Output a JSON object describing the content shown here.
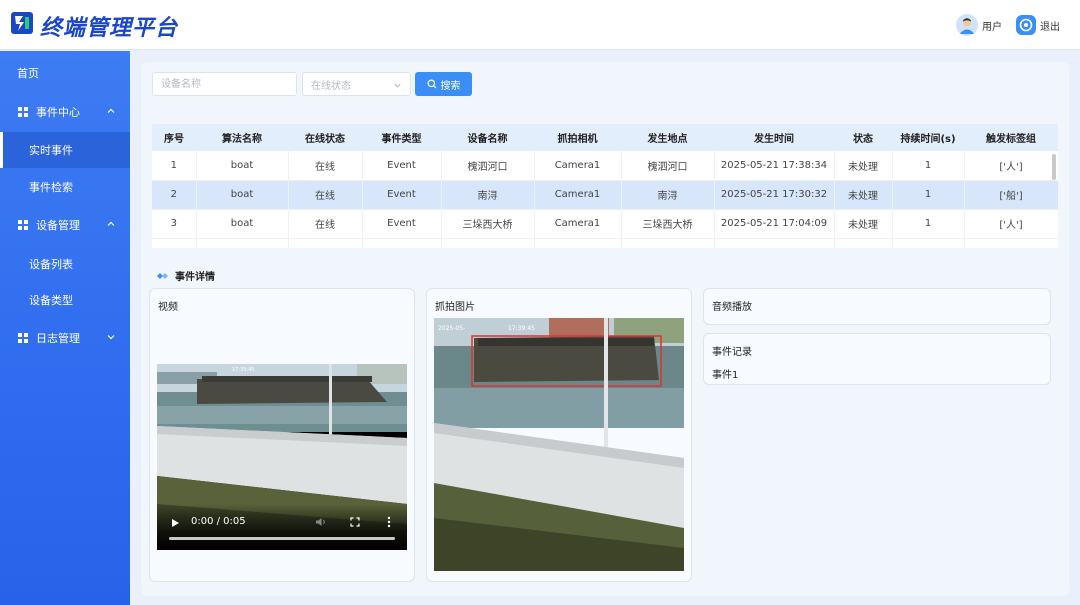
{
  "app": {
    "title": "终端管理平台"
  },
  "header": {
    "user_label": "用户",
    "logout_label": "退出"
  },
  "sidebar": {
    "items": [
      {
        "label": "首页",
        "level": 0
      },
      {
        "label": "事件中心",
        "level": 0,
        "expanded": true
      },
      {
        "label": "实时事件",
        "level": 1,
        "active": true
      },
      {
        "label": "事件检索",
        "level": 1
      },
      {
        "label": "设备管理",
        "level": 0,
        "expanded": true
      },
      {
        "label": "设备列表",
        "level": 1
      },
      {
        "label": "设备类型",
        "level": 1
      },
      {
        "label": "日志管理",
        "level": 0,
        "expanded": false
      }
    ]
  },
  "search": {
    "device_placeholder": "设备名称",
    "status_placeholder": "在线状态",
    "button_label": "搜索"
  },
  "table": {
    "headers": [
      "序号",
      "算法名称",
      "在线状态",
      "事件类型",
      "设备名称",
      "抓拍相机",
      "发生地点",
      "发生时间",
      "状态",
      "持续时间(s)",
      "触发标签组"
    ],
    "rows": [
      [
        "1",
        "boat",
        "在线",
        "Event",
        "槐泗河口",
        "Camera1",
        "槐泗河口",
        "2025-05-21 17:38:34",
        "未处理",
        "1",
        "['人']"
      ],
      [
        "2",
        "boat",
        "在线",
        "Event",
        "南浔",
        "Camera1",
        "南浔",
        "2025-05-21 17:30:32",
        "未处理",
        "1",
        "['船']"
      ],
      [
        "3",
        "boat",
        "在线",
        "Event",
        "三垛西大桥",
        "Camera1",
        "三垛西大桥",
        "2025-05-21 17:04:09",
        "未处理",
        "1",
        "['人']"
      ]
    ],
    "selected_row": 2
  },
  "details": {
    "section_title": "事件详情",
    "video": {
      "label": "视频",
      "time": "0:00 / 0:05",
      "overlay_time": "17:39:45"
    },
    "snapshot": {
      "label": "抓拍图片",
      "overlay_time": "17:39:45",
      "overlay_text": "2025-05-"
    },
    "audio": {
      "label": "音频播放"
    },
    "records": {
      "label": "事件记录",
      "items": [
        "事件1"
      ]
    }
  },
  "colors": {
    "primary": "#3a8ef5",
    "sidebar": "#2f6cef",
    "title": "#1a47c8",
    "selected_row": "#d7e6fb"
  }
}
